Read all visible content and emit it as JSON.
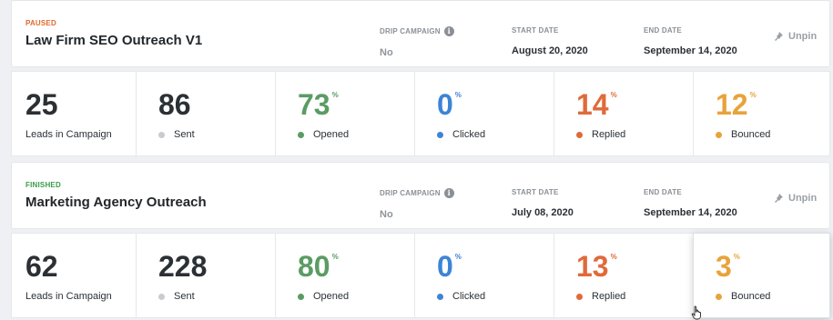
{
  "labels": {
    "drip_campaign": "DRIP CAMPAIGN",
    "start_date": "START DATE",
    "end_date": "END DATE",
    "unpin": "Unpin",
    "leads": "Leads in Campaign",
    "sent": "Sent",
    "opened": "Opened",
    "clicked": "Clicked",
    "replied": "Replied",
    "bounced": "Bounced",
    "percent": "%"
  },
  "colors": {
    "paused": "#e06a2c",
    "finished": "#3a9c4a",
    "opened": "#5a9c63",
    "clicked": "#3d84d6",
    "replied": "#e06a3a",
    "bounced": "#e8a33a",
    "sent": "#c8cbcf"
  },
  "campaigns": [
    {
      "status": "PAUSED",
      "name": "Law Firm SEO Outreach V1",
      "drip": "No",
      "start": "August 20, 2020",
      "end": "September 14, 2020",
      "leads": "25",
      "sent": "86",
      "opened": "73",
      "clicked": "0",
      "replied": "14",
      "bounced": "12"
    },
    {
      "status": "FINISHED",
      "name": "Marketing Agency Outreach",
      "drip": "No",
      "start": "July 08, 2020",
      "end": "September 14, 2020",
      "leads": "62",
      "sent": "228",
      "opened": "80",
      "clicked": "0",
      "replied": "13",
      "bounced": "3"
    }
  ]
}
